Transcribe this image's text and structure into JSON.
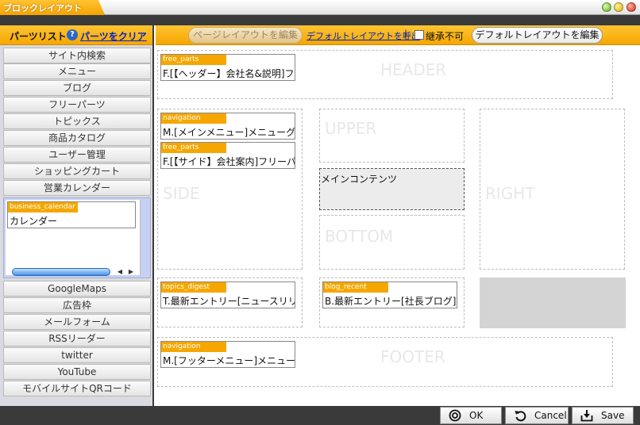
{
  "window": {
    "title": "ブロックレイアウト"
  },
  "left": {
    "title": "パーツリスト",
    "help_icon": "?",
    "clear_link": "パーツをクリア",
    "categories_top": [
      "サイト内検索",
      "メニュー",
      "ブログ",
      "フリーパーツ",
      "トピックス",
      "商品カタログ",
      "ユーザー管理",
      "ショッピングカート",
      "営業カレンダー"
    ],
    "calendar_part": {
      "tag": "business_calendar",
      "text": "カレンダー"
    },
    "categories_bottom": [
      "GoogleMaps",
      "広告枠",
      "メールフォーム",
      "RSSリーダー",
      "twitter",
      "YouTube",
      "モバイルサイトQRコード"
    ]
  },
  "toolbar": {
    "edit_page_layout": "ページレイアウトを編集",
    "call_default_layout": "デフォルトレイアウトを呼出",
    "separator": "|",
    "inherit_label": "継承不可",
    "edit_default_layout": "デフォルトレイアウトを編集"
  },
  "zones": {
    "header": "HEADER",
    "side": "SIDE",
    "upper": "UPPER",
    "main_contents": "メインコンテンツ",
    "bottom": "BOTTOM",
    "right": "RIGHT",
    "footer": "FOOTER"
  },
  "parts": {
    "header_part": {
      "tag": "free_parts",
      "text": "F.[【ヘッダー】会社名&説明]フ"
    },
    "side_nav": {
      "tag": "navigation",
      "text": "M.[メインメニュー]メニューグ/"
    },
    "side_free": {
      "tag": "free_parts",
      "text": "F.[【サイド】会社案内]フリーパー"
    },
    "topics": {
      "tag": "topics_digest",
      "text": "T.最新エントリー[ニュースリリー"
    },
    "blog": {
      "tag": "blog_recent",
      "text": "B.最新エントリー[社長ブログ]"
    },
    "footer_nav": {
      "tag": "navigation",
      "text": "M.[フッターメニュー]メニューク"
    }
  },
  "buttons": {
    "ok": "OK",
    "cancel": "Cancel",
    "save": "Save"
  },
  "icons": [
    "help-icon",
    "ok-icon",
    "cancel-icon",
    "save-icon",
    "scroll-left-icon",
    "scroll-right-icon"
  ],
  "colors": {
    "accent": "#f5a700",
    "dark": "#3a3a3a",
    "link": "#0022cc"
  }
}
